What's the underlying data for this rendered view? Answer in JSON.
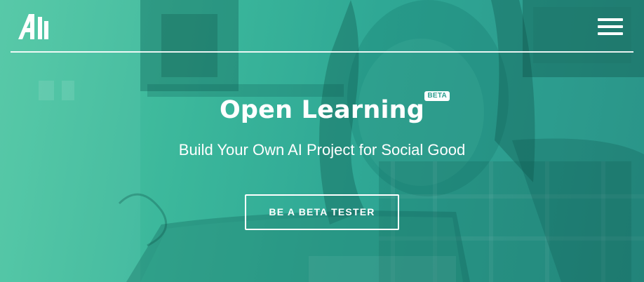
{
  "header": {
    "logo_icon": "ai-logo-icon",
    "menu_icon": "hamburger-menu-icon"
  },
  "hero": {
    "title": "Open Learning",
    "badge": "BETA",
    "subtitle": "Build Your Own AI Project for Social Good",
    "cta_label": "BE A BETA TESTER"
  },
  "colors": {
    "overlay_start": "#4fc7a4",
    "overlay_end": "#2a9488",
    "text": "#ffffff",
    "badge_text": "#2d9f90"
  }
}
